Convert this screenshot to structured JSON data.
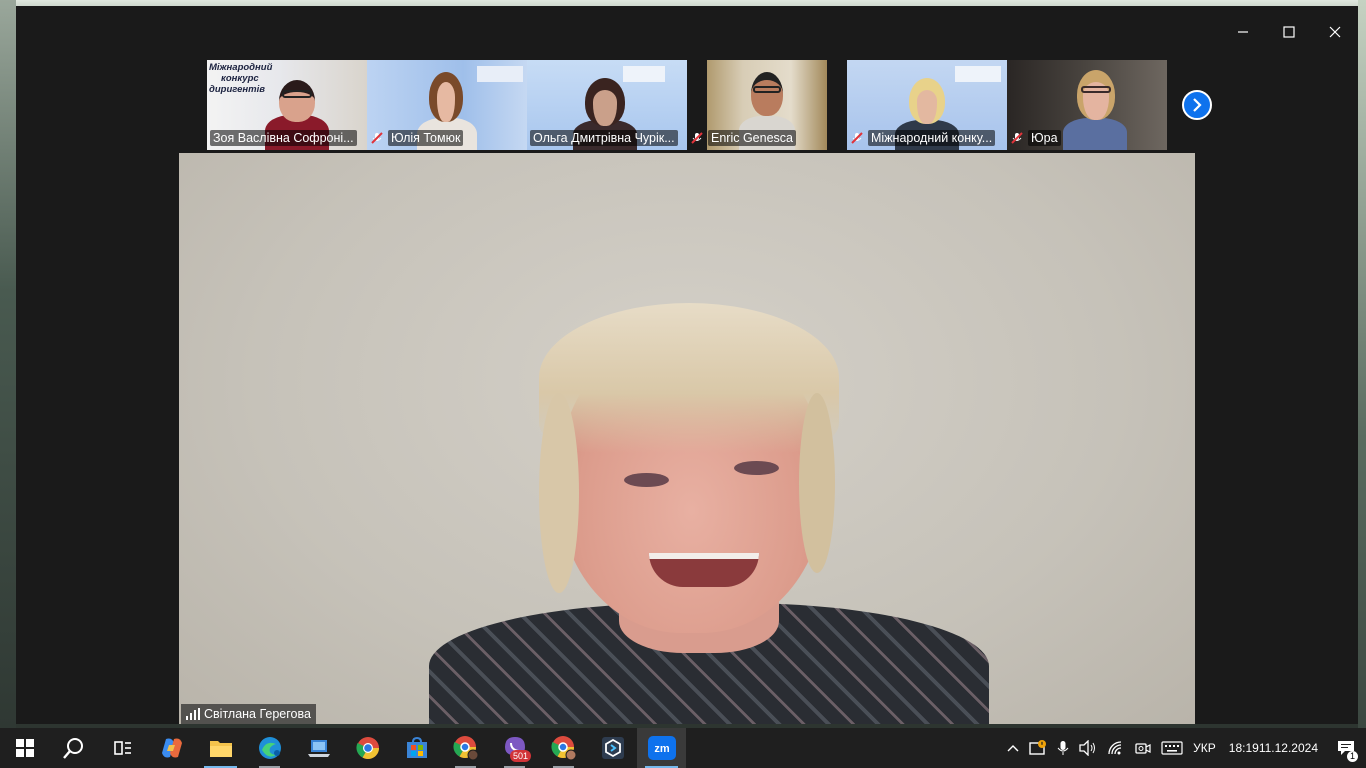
{
  "window": {
    "controls": {
      "minimize": "—",
      "maximize": "☐",
      "close": "✕"
    }
  },
  "gallery": {
    "participants": [
      {
        "name": "Зоя Васлівна Софроні...",
        "muted": false,
        "active": false,
        "banner_lines": [
          "Міжнародний",
          "конкурс",
          "диригентів"
        ]
      },
      {
        "name": "Юлія Томюк",
        "muted": true,
        "active": false
      },
      {
        "name": "Ольга Дмитрівна Чурік...",
        "muted": false,
        "active": true
      },
      {
        "name": "Enric Genesca",
        "muted": true,
        "active": false
      },
      {
        "name": "Міжнародний конку...",
        "muted": true,
        "active": false
      },
      {
        "name": "Юра",
        "muted": true,
        "active": false
      }
    ],
    "next_icon": "chevron-right-icon"
  },
  "main_video": {
    "speaker_name": "Світлана Герегова",
    "signal_icon": "signal-bars-icon"
  },
  "taskbar": {
    "apps": [
      "start",
      "search",
      "task-view",
      "copilot",
      "file-explorer",
      "edge",
      "laptop-app",
      "chrome",
      "store",
      "chrome-profile-1",
      "viber",
      "chrome-profile-2",
      "vpn-app",
      "zoom"
    ],
    "viber_badge": "501"
  },
  "tray": {
    "language": "УКР",
    "time": "18:19",
    "date": "11.12.2024",
    "notifications": "1"
  },
  "colors": {
    "active_border": "#23d18b",
    "zoom_blue": "#0e72ed",
    "window_bg": "#1a1a1a",
    "taskbar_bg": "#1f1f1f"
  }
}
